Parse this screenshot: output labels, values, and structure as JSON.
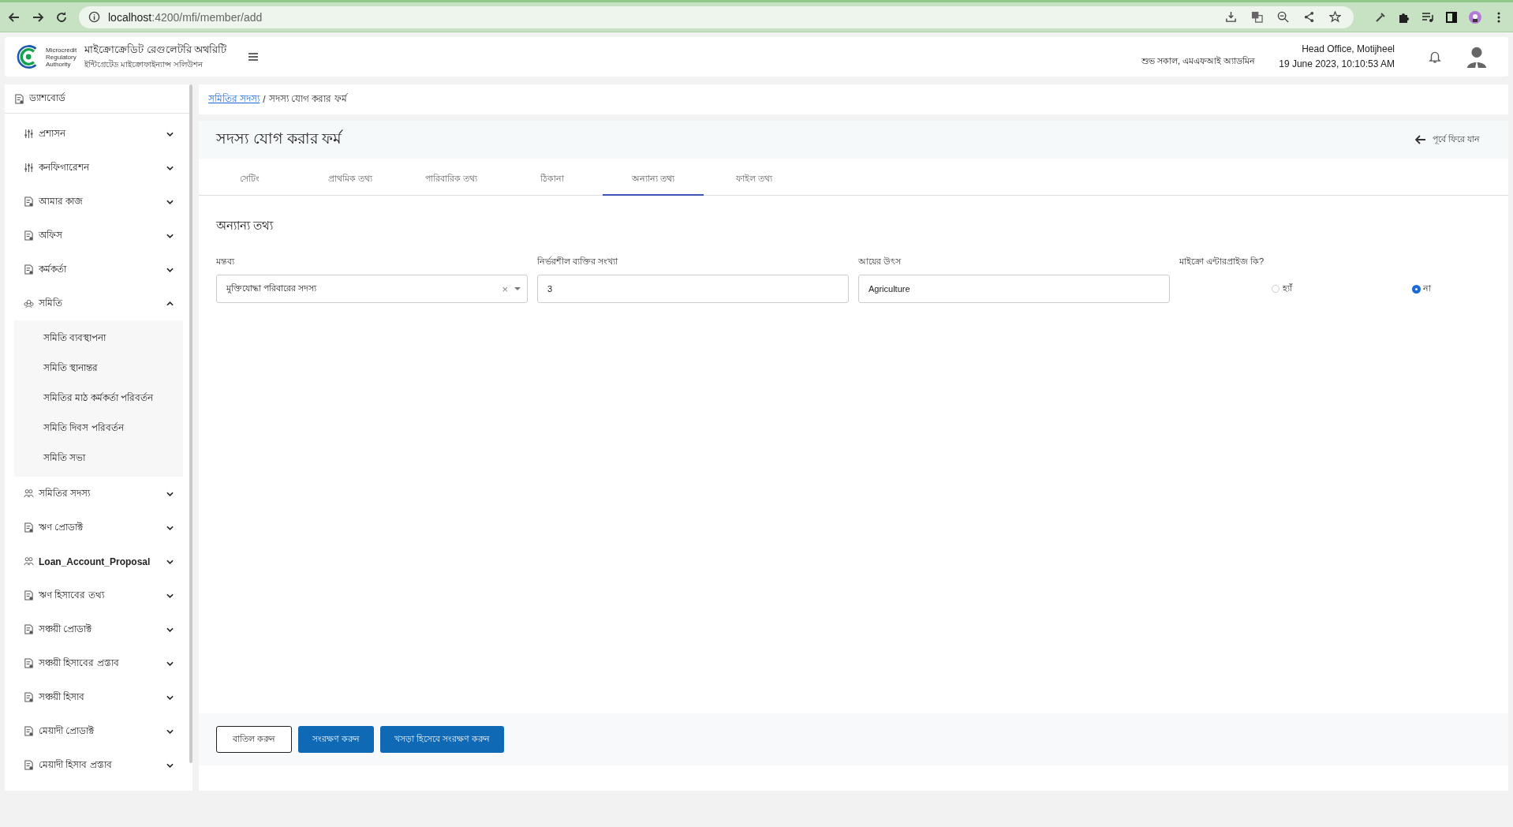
{
  "browser": {
    "url_host": "localhost",
    "url_path": ":4200/mfi/member/add"
  },
  "header": {
    "org_name": "মাইক্রোক্রেডিট রেগুলেটরি অথরিটি",
    "org_subtitle": "ইন্টিগ্রেটেড মাইক্রোফাইন্যান্স সলিউশন",
    "logo_lines": [
      "Microcredit",
      "Regulatory",
      "Authority"
    ],
    "greeting": "শুভ সকাল, এমএফআই অ্যাডমিন",
    "office": "Head Office, Motijheel",
    "datetime": "19 June 2023, 10:10:53 AM"
  },
  "sidebar": {
    "items": [
      {
        "label": "ড্যাশবোর্ড",
        "kind": "doc",
        "expandable": false
      },
      {
        "label": "প্রশাসন",
        "kind": "sliders",
        "expandable": true,
        "expanded": false
      },
      {
        "label": "কনফিগারেশন",
        "kind": "sliders",
        "expandable": true,
        "expanded": false
      },
      {
        "label": "আমার কাজ",
        "kind": "doc",
        "expandable": true,
        "expanded": false
      },
      {
        "label": "অফিস",
        "kind": "doc",
        "expandable": true,
        "expanded": false
      },
      {
        "label": "কর্মকর্তা",
        "kind": "doc",
        "expandable": true,
        "expanded": false
      },
      {
        "label": "সমিতি",
        "kind": "group",
        "expandable": true,
        "expanded": true,
        "children": [
          {
            "label": "সমিতি ব্যবস্থাপনা"
          },
          {
            "label": "সমিতি স্থানান্তর"
          },
          {
            "label": "সমিতির মাঠ কর্মকর্তা পরিবর্তন"
          },
          {
            "label": "সমিতি দিবস পরিবর্তন"
          },
          {
            "label": "সমিতি সভা"
          }
        ]
      },
      {
        "label": "সমিতির সদস্য",
        "kind": "people",
        "expandable": true,
        "expanded": false
      },
      {
        "label": "ঋণ প্রোডাক্ট",
        "kind": "doc",
        "expandable": true,
        "expanded": false
      },
      {
        "label": "Loan_Account_Proposal",
        "kind": "people",
        "expandable": true,
        "expanded": false
      },
      {
        "label": "ঋণ হিসাবের তথ্য",
        "kind": "doc",
        "expandable": true,
        "expanded": false
      },
      {
        "label": "সঞ্চয়ী প্রোডাক্ট",
        "kind": "doc",
        "expandable": true,
        "expanded": false
      },
      {
        "label": "সঞ্চয়ী হিসাবের প্রস্তাব",
        "kind": "doc",
        "expandable": true,
        "expanded": false
      },
      {
        "label": "সঞ্চয়ী হিসাব",
        "kind": "doc",
        "expandable": true,
        "expanded": false
      },
      {
        "label": "মেয়াদী প্রোডাক্ট",
        "kind": "doc",
        "expandable": true,
        "expanded": false
      },
      {
        "label": "মেয়াদী হিসাব প্রস্তাব",
        "kind": "doc",
        "expandable": true,
        "expanded": false
      }
    ]
  },
  "breadcrumb": {
    "link": "সমিতির সদস্য",
    "separator": "/",
    "current": "সদস্য যোগ করার ফর্ম"
  },
  "page_title": "সদস্য যোগ করার ফর্ম",
  "back_link": "পূর্বে ফিরে যান",
  "tabs": [
    {
      "label": "সেটিং",
      "selected": false
    },
    {
      "label": "প্রাথমিক তথ্য",
      "selected": false
    },
    {
      "label": "পারিবারিক তথ্য",
      "selected": false
    },
    {
      "label": "ঠিকানা",
      "selected": false
    },
    {
      "label": "অন্যান্য তথ্য",
      "selected": true
    },
    {
      "label": "ফাইল তথ্য",
      "selected": false
    }
  ],
  "section_title": "অন্যান্য তথ্য",
  "fields": [
    {
      "label": "মন্তব্য",
      "kind": "select",
      "value": "মুক্তিযোদ্ধা পরিবারের সদস্য",
      "clear": "×"
    },
    {
      "label": "নির্ভরশীল ব্যক্তির সংখ্যা",
      "kind": "text",
      "value": "3"
    },
    {
      "label": "আয়ের উৎস",
      "kind": "text",
      "value": "Agriculture"
    },
    {
      "label": "মাইক্রো এন্টারপ্রাইজ কি?",
      "kind": "radio",
      "options": [
        {
          "label": "হ্যাঁ",
          "selected": false
        },
        {
          "label": "না",
          "selected": true
        }
      ]
    }
  ],
  "buttons": [
    {
      "label": "বাতিল করুন",
      "kind": "outline"
    },
    {
      "label": "সংরক্ষণ করুন",
      "kind": "primary"
    },
    {
      "label": "খসড়া হিসেবে সংরক্ষণ করুন",
      "kind": "primary"
    }
  ]
}
